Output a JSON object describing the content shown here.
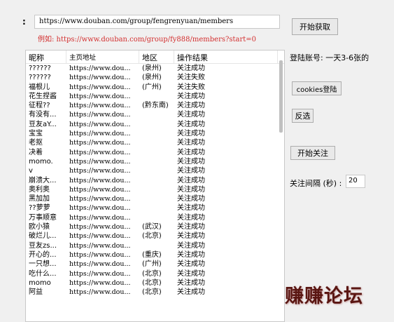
{
  "form": {
    "url_label": ":",
    "url_value": "https://www.douban.com/group/fengrenyuan/members",
    "example_text": "例如: https://www.douban.com/group/fy888/members?start=0",
    "start_button": "开始获取"
  },
  "side": {
    "login_account": "登陆账号: 一天3-6张的",
    "cookies_button": "cookies登陆",
    "invert_button": "反选",
    "follow_button": "开始关注",
    "interval_label": "关注间隔 (秒) :",
    "interval_value": "20"
  },
  "table": {
    "headers": [
      "昵称",
      "主页地址",
      "地区",
      "操作结果"
    ],
    "rows": [
      [
        "??????",
        "https://www.dou...",
        "(泉州)",
        "关注成功"
      ],
      [
        "??????",
        "https://www.dou...",
        "(泉州)",
        "关注失败"
      ],
      [
        "福根儿",
        "https://www.dou...",
        "(广州)",
        "关注失败"
      ],
      [
        "花生捏酱",
        "https://www.dou...",
        "",
        "关注成功"
      ],
      [
        "征程??",
        "https://www.dou...",
        "(黔东南)",
        "关注成功"
      ],
      [
        "有没有...",
        "https://www.dou...",
        "",
        "关注成功"
      ],
      [
        "豆友aY...",
        "https://www.dou...",
        "",
        "关注成功"
      ],
      [
        "宝宝",
        "https://www.dou...",
        "",
        "关注成功"
      ],
      [
        "老抠",
        "https://www.dou...",
        "",
        "关注成功"
      ],
      [
        "决着",
        "https://www.dou...",
        "",
        "关注成功"
      ],
      [
        "momo.",
        "https://www.dou...",
        "",
        "关注成功"
      ],
      [
        "v",
        "https://www.dou...",
        "",
        "关注成功"
      ],
      [
        "崩溃大...",
        "https://www.dou...",
        "",
        "关注成功"
      ],
      [
        "奥利奥",
        "https://www.dou...",
        "",
        "关注成功"
      ],
      [
        "黑加加",
        "https://www.dou...",
        "",
        "关注成功"
      ],
      [
        "??萝萝",
        "https://www.dou...",
        "",
        "关注成功"
      ],
      [
        "万事顺意",
        "https://www.dou...",
        "",
        "关注成功"
      ],
      [
        "欧小猿",
        "https://www.dou...",
        "(武汉)",
        "关注成功"
      ],
      [
        "破烂儿...",
        "https://www.dou...",
        "(北京)",
        "关注成功"
      ],
      [
        "豆友zs...",
        "https://www.dou...",
        "",
        "关注成功"
      ],
      [
        "开心的...",
        "https://www.dou...",
        "(重庆)",
        "关注成功"
      ],
      [
        "一只想...",
        "https://www.dou...",
        "(广州)",
        "关注成功"
      ],
      [
        "吃什么...",
        "https://www.dou...",
        "(北京)",
        "关注成功"
      ],
      [
        "momo",
        "https://www.dou...",
        "(北京)",
        "关注成功"
      ],
      [
        "阿益",
        "https://www.dou...",
        "(北京)",
        "关注成功"
      ]
    ]
  },
  "watermark": "赚赚论坛"
}
